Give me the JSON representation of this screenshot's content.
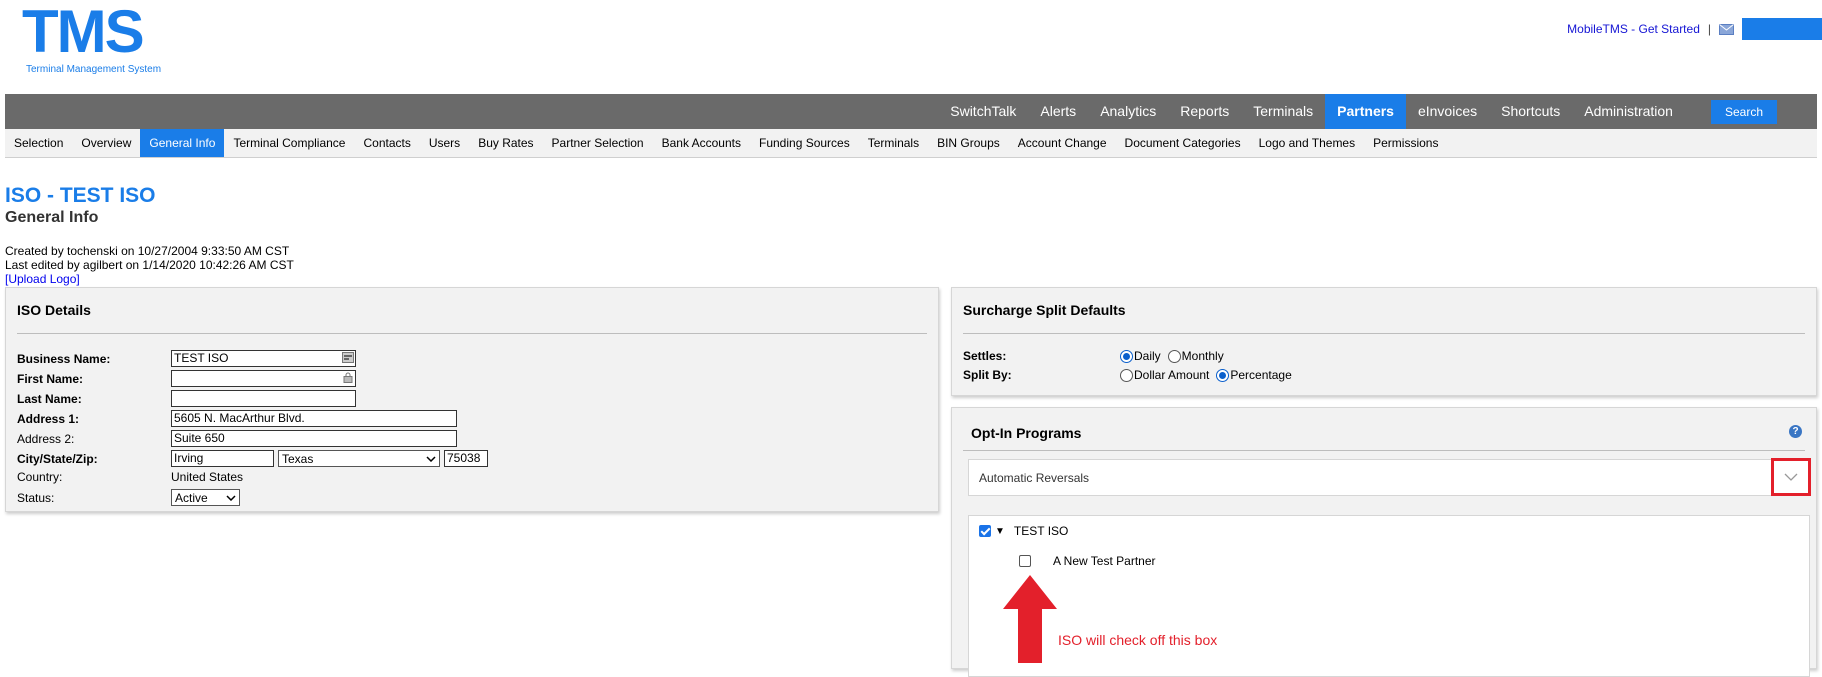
{
  "header": {
    "logo_text": "TMS",
    "logo_subtitle": "Terminal Management System",
    "mobile_link": "MobileTMS - Get Started",
    "separator": "|"
  },
  "main_nav": {
    "items": [
      "SwitchTalk",
      "Alerts",
      "Analytics",
      "Reports",
      "Terminals",
      "Partners",
      "eInvoices",
      "Shortcuts",
      "Administration"
    ],
    "active": "Partners",
    "search_label": "Search"
  },
  "sub_nav": {
    "items": [
      "Selection",
      "Overview",
      "General Info",
      "Terminal Compliance",
      "Contacts",
      "Users",
      "Buy Rates",
      "Partner Selection",
      "Bank Accounts",
      "Funding Sources",
      "Terminals",
      "BIN Groups",
      "Account Change",
      "Document Categories",
      "Logo and Themes",
      "Permissions"
    ],
    "active": "General Info"
  },
  "page": {
    "title": "ISO - TEST ISO",
    "subtitle": "General Info",
    "created": "Created by tochenski on 10/27/2004 9:33:50 AM CST",
    "edited": "Last edited by agilbert on 1/14/2020 10:42:26 AM CST",
    "upload_logo": "[Upload Logo]"
  },
  "iso_details": {
    "title": "ISO Details",
    "labels": {
      "business_name": "Business Name:",
      "first_name": "First Name:",
      "last_name": "Last Name:",
      "address1": "Address 1:",
      "address2": "Address 2:",
      "city_state_zip": "City/State/Zip:",
      "country": "Country:",
      "status": "Status:"
    },
    "values": {
      "business_name": "TEST ISO",
      "first_name": "",
      "last_name": "",
      "address1": "5605 N. MacArthur Blvd.",
      "address2": "Suite 650",
      "city": "Irving",
      "state": "Texas",
      "zip": "75038",
      "country": "United States",
      "status": "Active"
    }
  },
  "surcharge": {
    "title": "Surcharge Split Defaults",
    "settles_label": "Settles:",
    "settles_options": [
      "Daily",
      "Monthly"
    ],
    "settles_selected": "Daily",
    "split_label": "Split By:",
    "split_options": [
      "Dollar Amount",
      "Percentage"
    ],
    "split_selected": "Percentage"
  },
  "opt_in": {
    "title": "Opt-In Programs",
    "help": "?",
    "dropdown_label": "Automatic Reversals",
    "tree": {
      "parent": "TEST ISO",
      "parent_checked": true,
      "child": "A New Test Partner",
      "child_checked": false
    }
  },
  "annotation": {
    "text": "ISO will check off this box",
    "color": "#e3202b"
  },
  "colors": {
    "brand": "#1a7de8",
    "nav_bg": "#6a6a6a",
    "subnav_bg": "#f2f2f2"
  }
}
